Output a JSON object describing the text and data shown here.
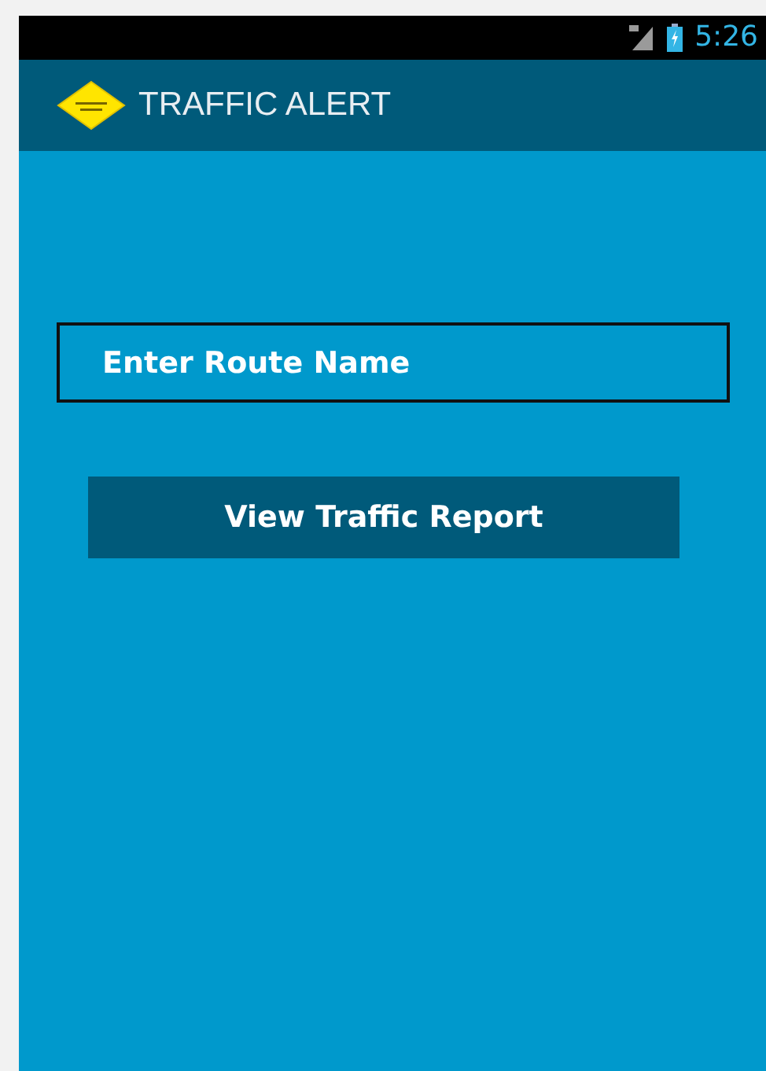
{
  "status_bar": {
    "time": "5:26"
  },
  "app_bar": {
    "title": "TRAFFIC ALERT"
  },
  "route_field": {
    "placeholder": "Enter Route Name"
  },
  "buttons": [
    "View Traffic Report"
  ]
}
